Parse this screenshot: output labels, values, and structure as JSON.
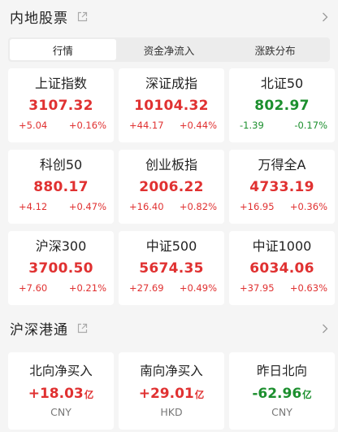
{
  "market_section": {
    "title": "内地股票",
    "tabs": [
      {
        "label": "行情",
        "active": true
      },
      {
        "label": "资金净流入",
        "active": false
      },
      {
        "label": "涨跌分布",
        "active": false
      }
    ],
    "indices": [
      {
        "name": "上证指数",
        "value": "3107.32",
        "change": "+5.04",
        "pct": "+0.16%",
        "direction": "up"
      },
      {
        "name": "深证成指",
        "value": "10104.32",
        "change": "+44.17",
        "pct": "+0.44%",
        "direction": "up"
      },
      {
        "name": "北证50",
        "value": "802.97",
        "change": "-1.39",
        "pct": "-0.17%",
        "direction": "down"
      },
      {
        "name": "科创50",
        "value": "880.17",
        "change": "+4.12",
        "pct": "+0.47%",
        "direction": "up"
      },
      {
        "name": "创业板指",
        "value": "2006.22",
        "change": "+16.40",
        "pct": "+0.82%",
        "direction": "up"
      },
      {
        "name": "万得全A",
        "value": "4733.19",
        "change": "+16.95",
        "pct": "+0.36%",
        "direction": "up"
      },
      {
        "name": "沪深300",
        "value": "3700.50",
        "change": "+7.60",
        "pct": "+0.21%",
        "direction": "up"
      },
      {
        "name": "中证500",
        "value": "5674.35",
        "change": "+27.69",
        "pct": "+0.49%",
        "direction": "up"
      },
      {
        "name": "中证1000",
        "value": "6034.06",
        "change": "+37.95",
        "pct": "+0.63%",
        "direction": "up"
      }
    ]
  },
  "connect_section": {
    "title": "沪深港通",
    "cards": [
      {
        "name": "北向净买入",
        "value": "+18.03",
        "unit": "亿",
        "currency": "CNY",
        "direction": "up"
      },
      {
        "name": "南向净买入",
        "value": "+29.01",
        "unit": "亿",
        "currency": "HKD",
        "direction": "up"
      },
      {
        "name": "昨日北向",
        "value": "-62.96",
        "unit": "亿",
        "currency": "CNY",
        "direction": "down"
      }
    ]
  },
  "icons": {
    "share": "share-icon",
    "chevron": "chevron-right-icon"
  },
  "colors": {
    "up": "#e03131",
    "down": "#1c8f2e",
    "background": "#f5f5f5",
    "card": "#ffffff"
  }
}
